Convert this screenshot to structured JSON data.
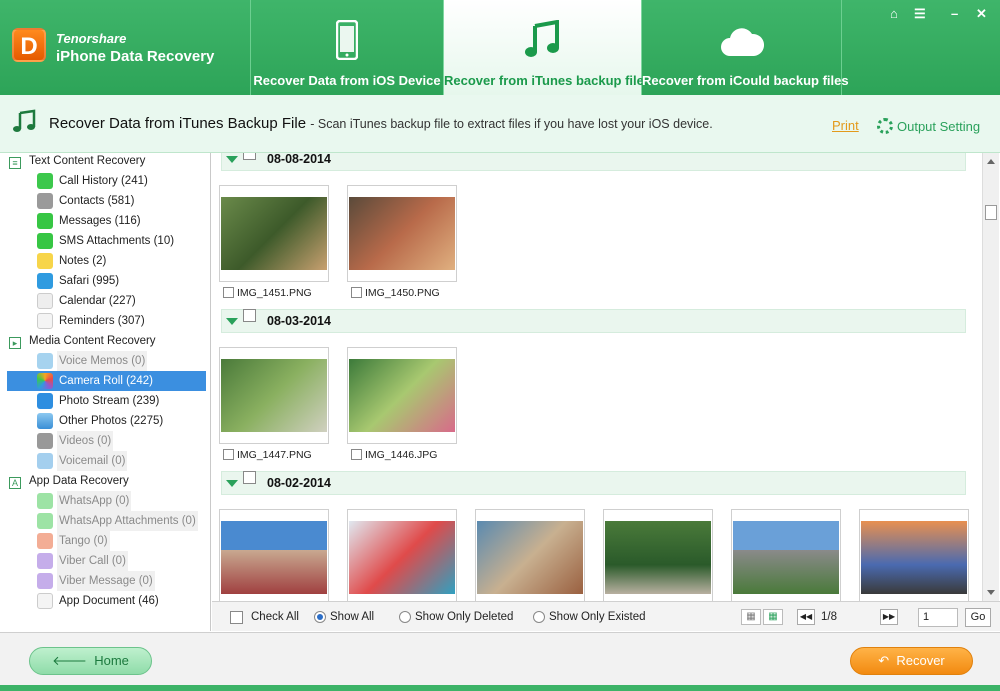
{
  "app": {
    "brand": "Tenorshare",
    "name": "iPhone Data Recovery"
  },
  "tabs": [
    {
      "label": "Recover Data from iOS Device",
      "icon": "phone-icon"
    },
    {
      "label": "Recover from iTunes backup files",
      "icon": "music-note-icon",
      "active": true
    },
    {
      "label": "Recover from iCould backup files",
      "icon": "cloud-icon"
    }
  ],
  "window_controls": [
    "home-icon",
    "menu-icon",
    "minimize-icon",
    "close-icon"
  ],
  "subheader": {
    "title": "Recover Data from iTunes Backup File",
    "description": "- Scan iTunes backup file to extract files if you have lost your iOS device.",
    "print": "Print",
    "output_setting": "Output Setting"
  },
  "sidebar": {
    "categories": [
      {
        "label": "Text Content Recovery",
        "items": [
          {
            "label": "Call History (241)",
            "color": "#3cc84c"
          },
          {
            "label": "Contacts (581)",
            "color": "#9a9a9a"
          },
          {
            "label": "Messages (116)",
            "color": "#37c644"
          },
          {
            "label": "SMS Attachments (10)",
            "color": "#37c644"
          },
          {
            "label": "Notes (2)",
            "color": "#f7d54a"
          },
          {
            "label": "Safari (995)",
            "color": "#2f9be0"
          },
          {
            "label": "Calendar (227)",
            "color": "#eeeeee"
          },
          {
            "label": "Reminders (307)",
            "color": "#f4f4f4"
          }
        ]
      },
      {
        "label": "Media Content Recovery",
        "items": [
          {
            "label": "Voice Memos (0)",
            "color": "#4da8e0",
            "disabled": true
          },
          {
            "label": "Camera Roll (242)",
            "color": "#f6a623",
            "selected": true
          },
          {
            "label": "Photo Stream (239)",
            "color": "#2e8ee0"
          },
          {
            "label": "Other Photos (2275)",
            "color": "#3a8fd6"
          },
          {
            "label": "Videos (0)",
            "color": "#333333",
            "disabled": true
          },
          {
            "label": "Voicemail (0)",
            "color": "#4aa0de",
            "disabled": true
          }
        ]
      },
      {
        "label": "App Data Recovery",
        "items": [
          {
            "label": "WhatsApp (0)",
            "color": "#3cc84c",
            "disabled": true
          },
          {
            "label": "WhatsApp Attachments (0)",
            "color": "#3cc84c",
            "disabled": true
          },
          {
            "label": "Tango (0)",
            "color": "#e85b2b",
            "disabled": true
          },
          {
            "label": "Viber Call (0)",
            "color": "#8b5bd6",
            "disabled": true
          },
          {
            "label": "Viber Message (0)",
            "color": "#8b5bd6",
            "disabled": true
          },
          {
            "label": "App Document (46)",
            "color": "#f4f4f4"
          }
        ]
      }
    ]
  },
  "groups": [
    {
      "date": "08-08-2014",
      "photos": [
        {
          "name": "IMG_1451.PNG",
          "colors": [
            "#6a8a4a",
            "#3d5a2a",
            "#c8a070"
          ]
        },
        {
          "name": "IMG_1450.PNG",
          "colors": [
            "#5a4a3a",
            "#b86a4a",
            "#e0b080"
          ]
        }
      ]
    },
    {
      "date": "08-03-2014",
      "photos": [
        {
          "name": "IMG_1447.PNG",
          "colors": [
            "#4a7a3a",
            "#8ab060",
            "#d0d0c0"
          ]
        },
        {
          "name": "IMG_1446.JPG",
          "colors": [
            "#3c7a3a",
            "#a8c870",
            "#d86a8a"
          ]
        }
      ]
    },
    {
      "date": "08-02-2014",
      "photos": [
        {
          "name": "",
          "colors": [
            "#4a8ad0",
            "#c8a890",
            "#a04040"
          ]
        },
        {
          "name": "",
          "colors": [
            "#e0e8f0",
            "#e04a4a",
            "#30a0c0"
          ]
        },
        {
          "name": "",
          "colors": [
            "#5a8ab0",
            "#c8b090",
            "#9a6040"
          ]
        },
        {
          "name": "",
          "colors": [
            "#4a7a3a",
            "#2a5a2a",
            "#b8b0a0"
          ]
        },
        {
          "name": "",
          "colors": [
            "#6aa0d8",
            "#8a8a8a",
            "#4a7a3a"
          ]
        },
        {
          "name": "",
          "colors": [
            "#e89050",
            "#4a6ab0",
            "#3a3a3a"
          ]
        }
      ]
    }
  ],
  "filter": {
    "check_all": "Check All",
    "show_all": "Show All",
    "show_deleted": "Show Only Deleted",
    "show_existed": "Show Only Existed",
    "page": "1/8",
    "page_input": "1",
    "go": "Go"
  },
  "footer": {
    "home": "Home",
    "recover": "Recover"
  }
}
